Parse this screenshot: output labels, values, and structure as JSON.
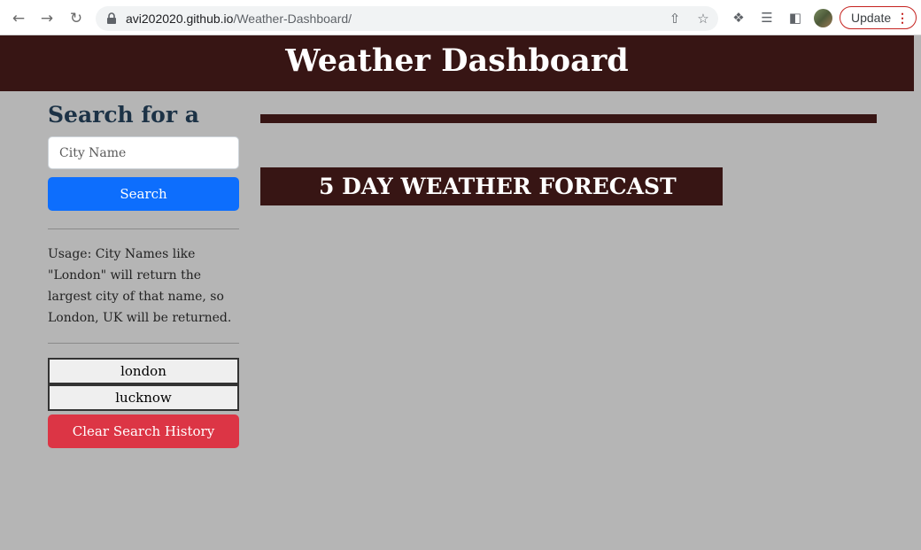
{
  "browser": {
    "url_host": "avi202020.github.io",
    "url_path": "/Weather-Dashboard/",
    "update_label": "Update"
  },
  "header": {
    "title": "Weather Dashboard"
  },
  "sidebar": {
    "heading": "Search for a City:",
    "search_placeholder": "City Name",
    "search_value": "",
    "search_label": "Search",
    "usage_text": "Usage: City Names like \"London\" will return the largest city of that name, so London, UK will be returned.",
    "history": [
      "london",
      "lucknow"
    ],
    "clear_label": "Clear Search History"
  },
  "main": {
    "forecast_title": "5 DAY WEATHER FORECAST"
  },
  "colors": {
    "header_bg": "#371514",
    "page_bg": "#b5b5b5",
    "search_btn": "#0d6efd",
    "clear_btn": "#dc3545",
    "heading_text": "#1c3246"
  }
}
